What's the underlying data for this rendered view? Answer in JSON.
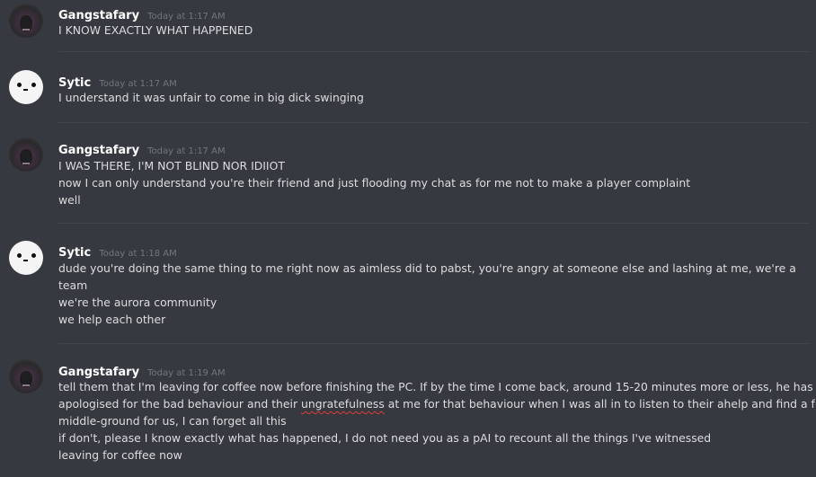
{
  "messages": [
    {
      "author": "Gangstafary",
      "timestamp": "Today at 1:17 AM",
      "lines": [
        "I KNOW EXACTLY WHAT HAPPENED"
      ]
    },
    {
      "author": "Sytic",
      "timestamp": "Today at 1:17 AM",
      "lines": [
        "I understand it was unfair to come in big dick swinging"
      ]
    },
    {
      "author": "Gangstafary",
      "timestamp": "Today at 1:17 AM",
      "lines": [
        "I WAS THERE, I'M NOT BLIND NOR IDIIOT",
        "now I can only understand you're their friend and just flooding my chat as for me not to make a player complaint",
        "well"
      ]
    },
    {
      "author": "Sytic",
      "timestamp": "Today at 1:18 AM",
      "lines": [
        "dude you're doing the same thing to me right now as aimless did to pabst, you're angry at someone else and lashing at me, we're a",
        "team",
        "we're the aurora community",
        "we help each other"
      ]
    },
    {
      "author": "Gangstafary",
      "timestamp": "Today at 1:19 AM",
      "lines": [
        "tell them that I'm leaving for coffee now before finishing the PC. If by the time I come back, around 15-20 minutes more or less, he has",
        "apologised for the bad behaviour and their ",
        "ungratefulness",
        " at me for that behaviour when I was all in to listen to their ahelp and find a funny",
        "middle-ground for us, I can forget all this",
        "if don't, please I know exactly what has happened, I do not need you as a pAI to recount all the things I've witnessed",
        "leaving for coffee now"
      ]
    }
  ]
}
